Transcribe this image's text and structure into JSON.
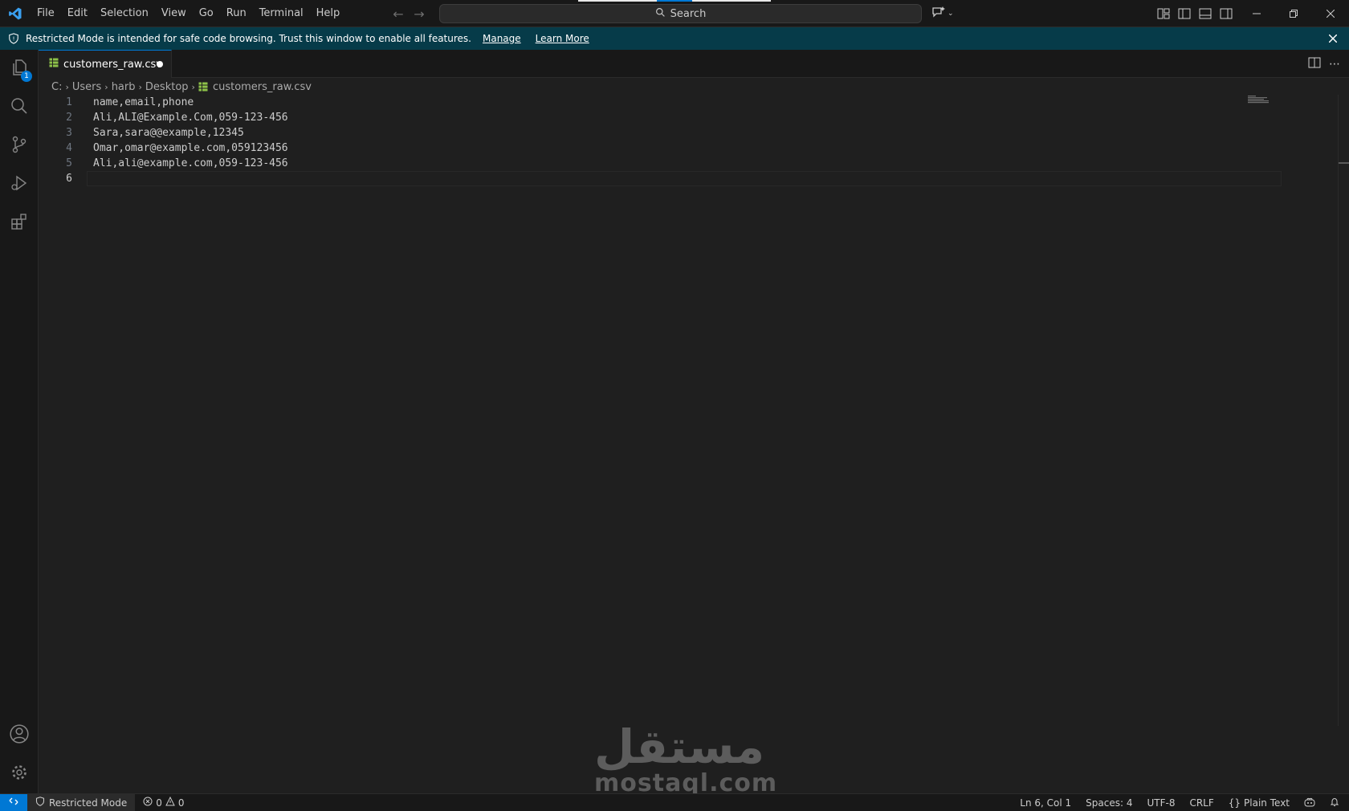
{
  "menu": [
    "File",
    "Edit",
    "Selection",
    "View",
    "Go",
    "Run",
    "Terminal",
    "Help"
  ],
  "search": {
    "label": "Search"
  },
  "banner": {
    "text": "Restricted Mode is intended for safe code browsing. Trust this window to enable all features.",
    "manage": "Manage",
    "learn_more": "Learn More"
  },
  "activity": {
    "explorer_badge": "1"
  },
  "tab": {
    "filename": "customers_raw.csv"
  },
  "breadcrumb": [
    "C:",
    "Users",
    "harb",
    "Desktop",
    "customers_raw.csv"
  ],
  "editor": {
    "lines": [
      {
        "num": "1",
        "text": "name,email,phone"
      },
      {
        "num": "2",
        "text": "Ali,ALI@Example.Com,059-123-456"
      },
      {
        "num": "3",
        "text": "Sara,sara@@example,12345"
      },
      {
        "num": "4",
        "text": "Omar,omar@example.com,059123456"
      },
      {
        "num": "5",
        "text": "Ali,ali@example.com,059-123-456"
      },
      {
        "num": "6",
        "text": ""
      }
    ]
  },
  "watermark": {
    "arabic": "مستقل",
    "latin": "mostaql.com"
  },
  "status": {
    "restricted": "Restricted Mode",
    "errors": "0",
    "warnings": "0",
    "position": "Ln 6, Col 1",
    "spaces": "Spaces: 4",
    "encoding": "UTF-8",
    "eol": "CRLF",
    "language": "Plain Text"
  },
  "colors": {
    "accent": "#0078d4",
    "banner": "#063b49",
    "csv_icon": "#8dc149"
  }
}
